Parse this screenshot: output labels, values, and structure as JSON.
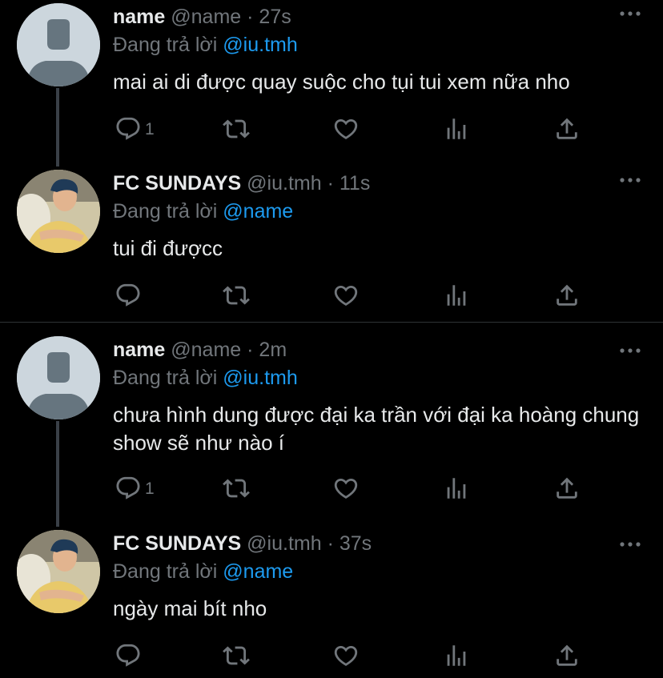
{
  "colors": {
    "background": "#000000",
    "text": "#e7e9ea",
    "muted": "#71767b",
    "mention": "#1d9bf0",
    "thread_line": "#3a4047",
    "divider": "#2f3336",
    "default_avatar": "#ccd6dd"
  },
  "tweets": [
    {
      "display_name": "name",
      "handle": "@name",
      "time": "27s",
      "reply_prefix": "Đang trả lời",
      "reply_to": "@iu.tmh",
      "text": "mai ai di được quay suộc cho tụi tui xem nữa nho",
      "reply_count": "1",
      "avatar": "default-avatar-icon"
    },
    {
      "display_name": "FC SUNDAYS",
      "handle": "@iu.tmh",
      "time": "11s",
      "reply_prefix": "Đang trả lời",
      "reply_to": "@name",
      "text": "tui đi đượcc",
      "reply_count": "",
      "avatar": "profile-photo"
    },
    {
      "display_name": "name",
      "handle": "@name",
      "time": "2m",
      "reply_prefix": "Đang trả lời",
      "reply_to": "@iu.tmh",
      "text": "chưa hình dung được đại ka trần với đại ka hoàng chung show sẽ như nào í",
      "reply_count": "1",
      "avatar": "default-avatar-icon"
    },
    {
      "display_name": "FC SUNDAYS",
      "handle": "@iu.tmh",
      "time": "37s",
      "reply_prefix": "Đang trả lời",
      "reply_to": "@name",
      "text": "ngày mai bít nho",
      "reply_count": "",
      "avatar": "profile-photo"
    }
  ],
  "icons": {
    "reply": "reply-icon",
    "retweet": "retweet-icon",
    "like": "heart-icon",
    "analytics": "analytics-icon",
    "share": "share-icon",
    "more": "more-options-icon"
  }
}
